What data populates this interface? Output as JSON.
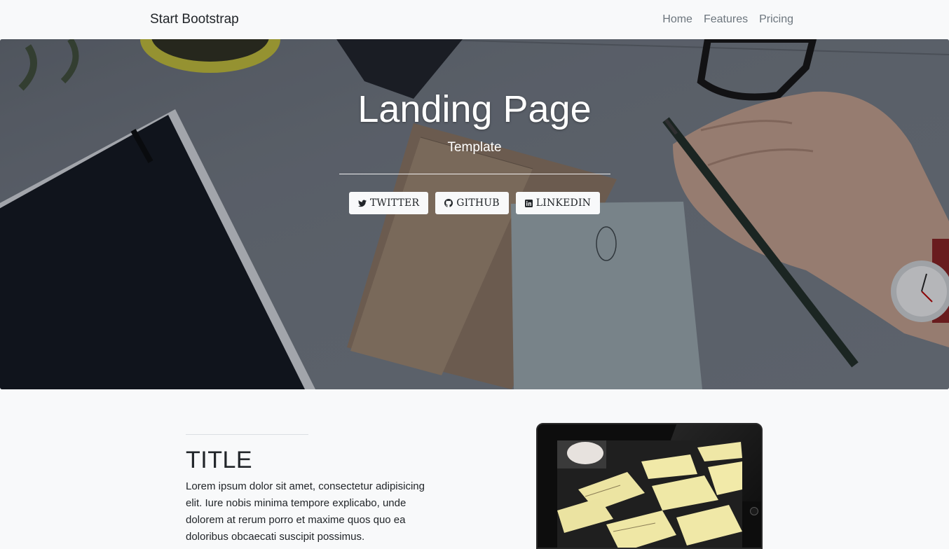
{
  "navbar": {
    "brand": "Start Bootstrap",
    "links": [
      {
        "label": "Home"
      },
      {
        "label": "Features"
      },
      {
        "label": "Pricing"
      }
    ]
  },
  "hero": {
    "title": "Landing Page",
    "subtitle": "Template",
    "buttons": [
      {
        "label": "TWITTER",
        "icon": "twitter-icon"
      },
      {
        "label": "GITHUB",
        "icon": "github-icon"
      },
      {
        "label": "LINKEDIN",
        "icon": "linkedin-icon"
      }
    ]
  },
  "section": {
    "title": "TITLE",
    "body": "Lorem ipsum dolor sit amet, consectetur adipisicing elit. Iure nobis minima tempore explicabo, unde dolorem at rerum porro et maxime quos quo ea doloribus obcaecati suscipit possimus."
  },
  "colors": {
    "page_bg": "#f8f9fa",
    "nav_link": "#6c757d",
    "text": "#212529",
    "hero_text": "#ffffff"
  }
}
